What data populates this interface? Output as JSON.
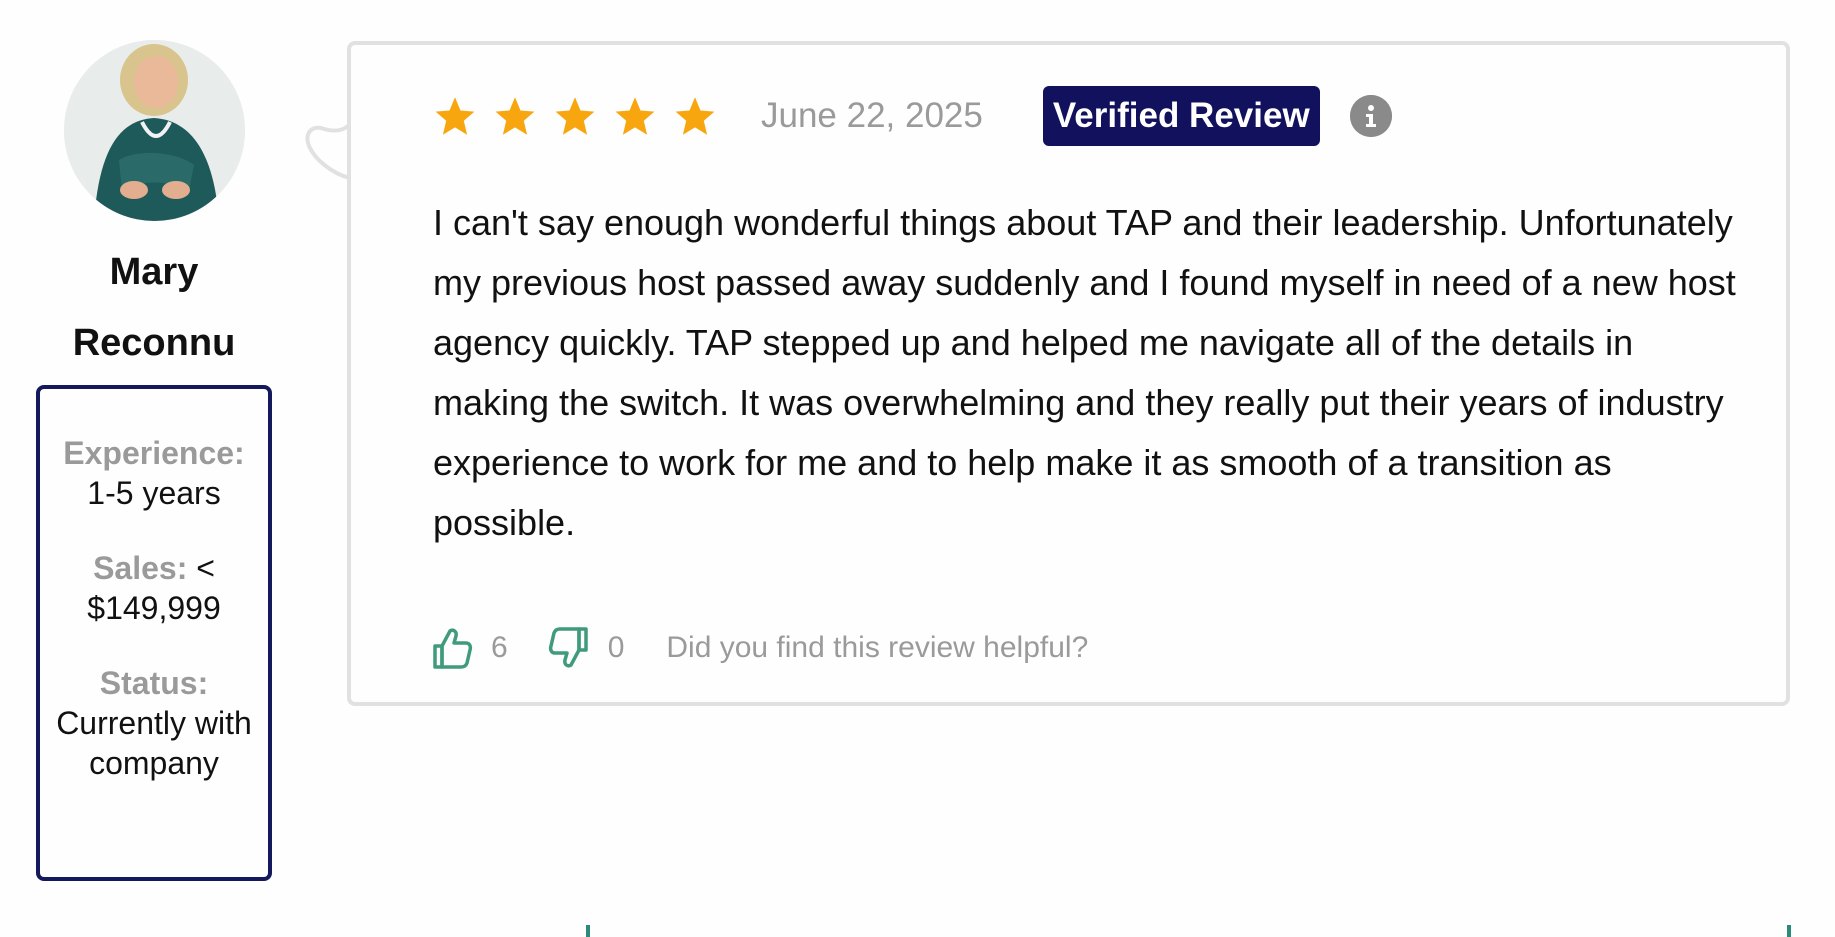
{
  "reviewer": {
    "name": "Mary Reconnu",
    "avatar_icon": "reviewer-photo",
    "experience_label": "Experience:",
    "experience_value": "1-5 years",
    "sales_label": "Sales:",
    "sales_value": "< $149,999",
    "status_label": "Status:",
    "status_value": "Currently with company"
  },
  "review": {
    "rating": 5,
    "rating_max": 5,
    "star_icon": "star-icon",
    "date": "June 22, 2025",
    "badge": "Verified Review",
    "info_icon": "info-icon",
    "text": "I can't say enough wonderful things about TAP and their leadership. Unfortunately my previous host passed away suddenly and I found myself in need of a new host agency quickly. TAP stepped up and helped me navigate all of the details in making the switch. It was overwhelming and they really put their years of industry experience to work for me and to help make it as smooth of a transition as possible.",
    "helpful_up_count": "6",
    "helpful_down_count": "0",
    "helpful_question": "Did you find this review helpful?"
  },
  "colors": {
    "accent_navy": "#14185c",
    "badge_bg": "#11115e",
    "star": "#f8a60f",
    "thumb": "#3f9b7c",
    "muted_text": "#9a9a9a",
    "card_border": "#e1e1e1"
  }
}
